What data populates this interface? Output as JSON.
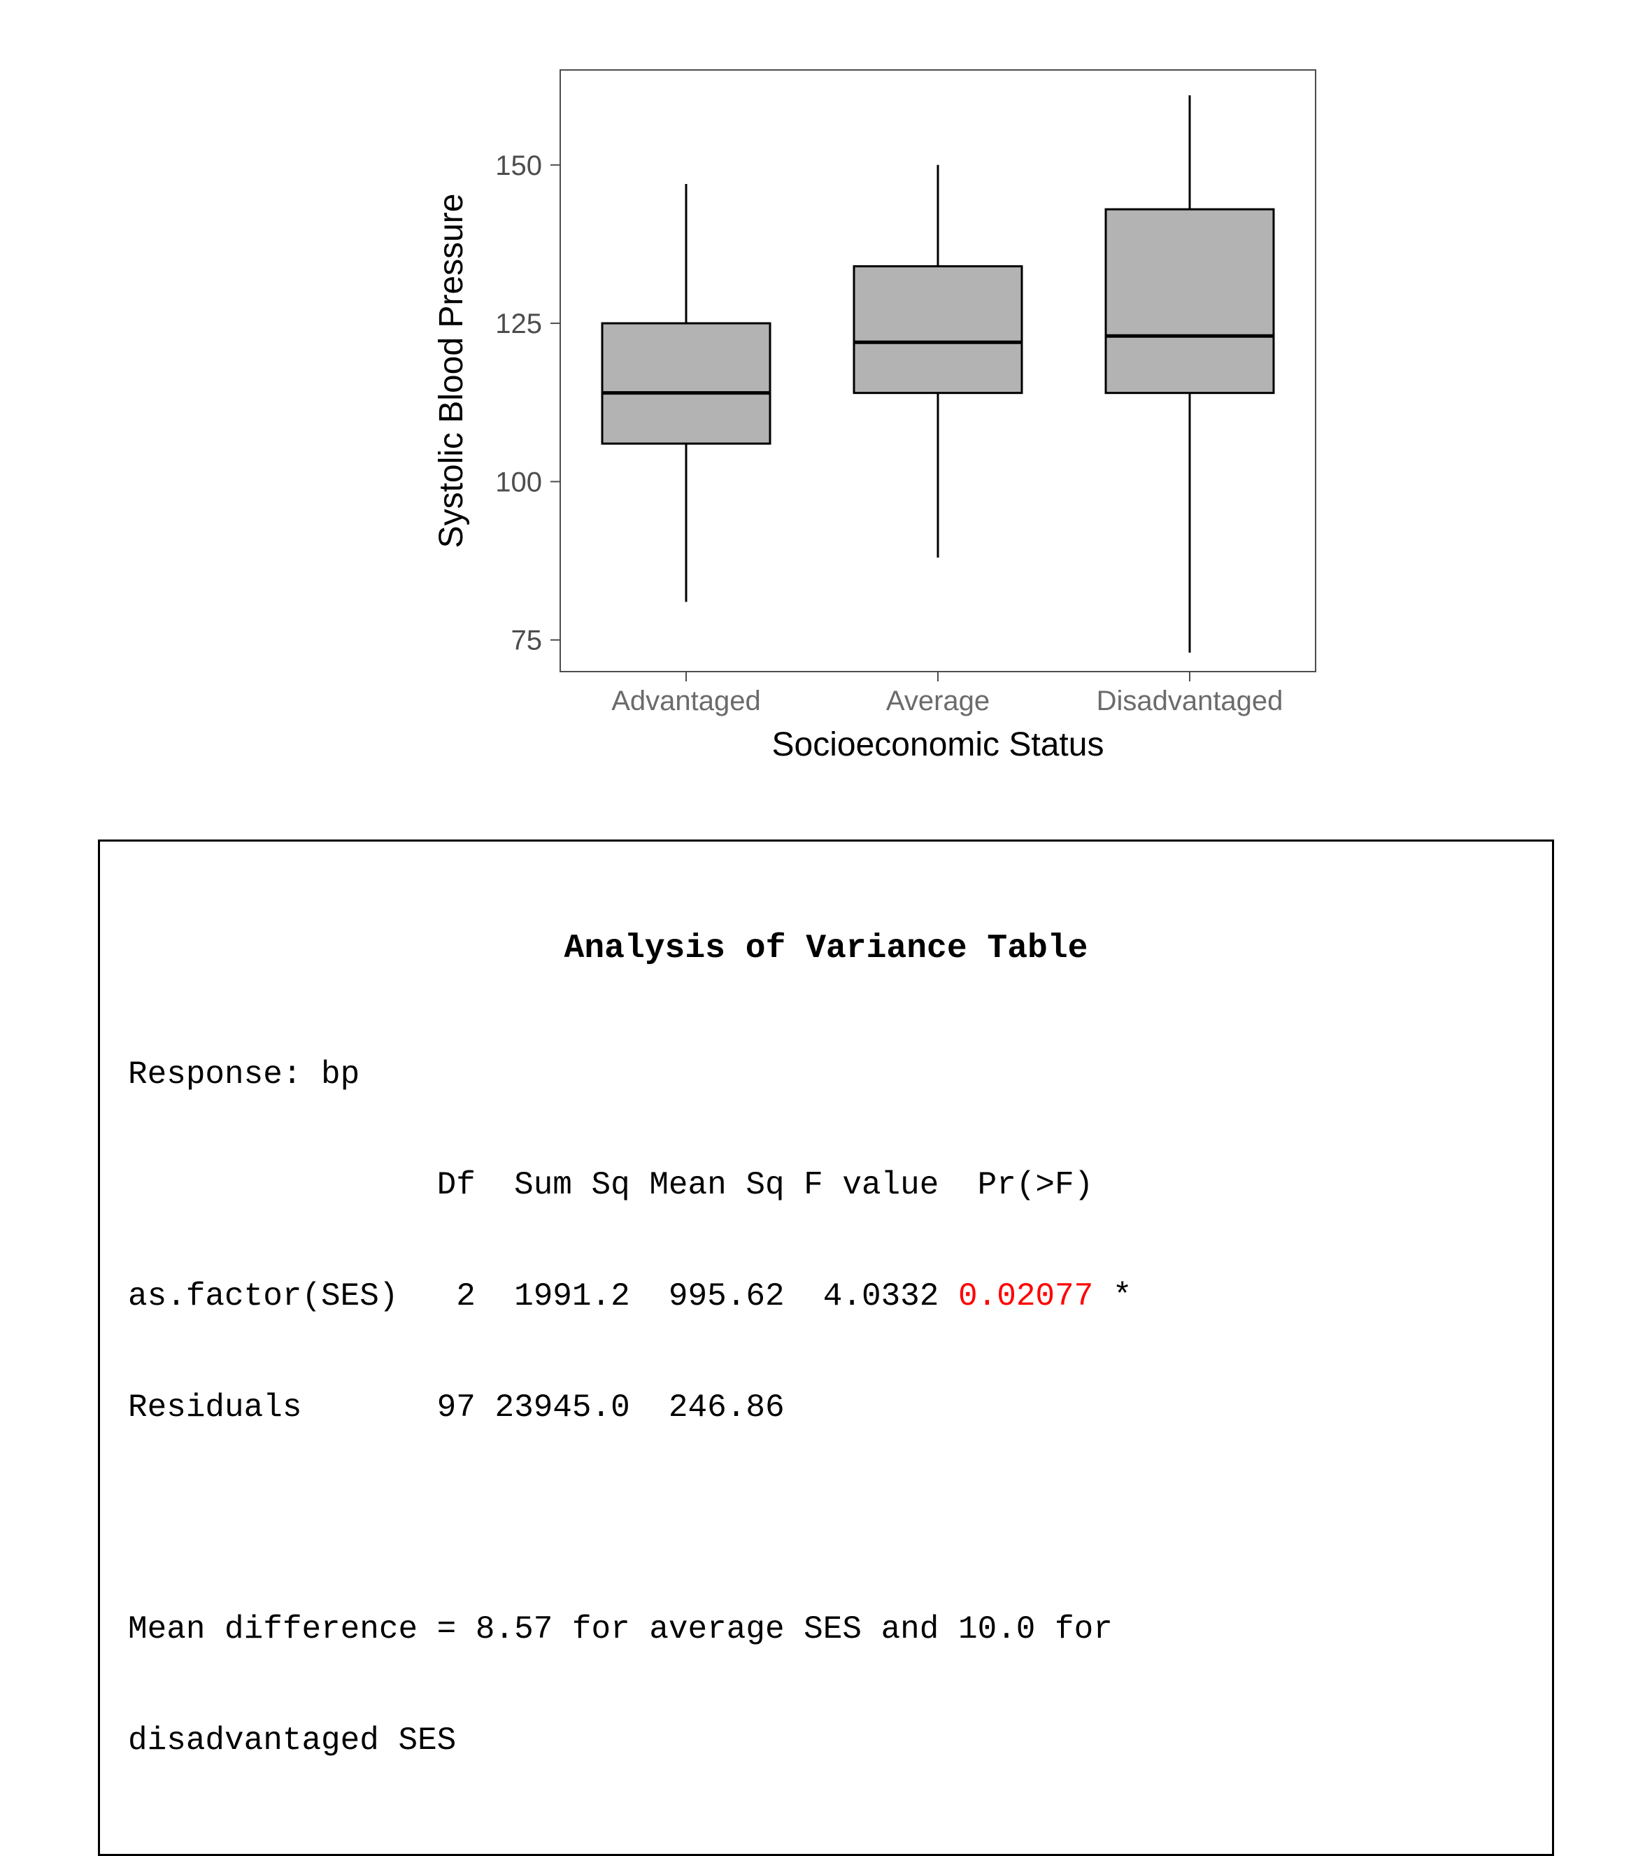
{
  "chart_data": {
    "type": "boxplot",
    "xlabel": "Socioeconomic Status",
    "ylabel": "Systolic Blood Pressure",
    "categories": [
      "Advantaged",
      "Average",
      "Disadvantaged"
    ],
    "y_ticks": [
      75,
      100,
      125,
      150
    ],
    "ylim": [
      70,
      165
    ],
    "series": [
      {
        "name": "Advantaged",
        "min": 81,
        "q1": 106,
        "median": 114,
        "q3": 125,
        "max": 147
      },
      {
        "name": "Average",
        "min": 88,
        "q1": 114,
        "median": 122,
        "q3": 134,
        "max": 150
      },
      {
        "name": "Disadvantaged",
        "min": 73,
        "q1": 114,
        "median": 123,
        "q3": 143,
        "max": 161
      }
    ]
  },
  "anova": {
    "title": "Analysis of Variance Table",
    "response_label": "Response: bp",
    "header": "                Df  Sum Sq Mean Sq F value  Pr(>F)",
    "row_factor_a": "as.factor(SES)   2  1991.2  995.62  4.0332 ",
    "row_factor_p": "0.02077",
    "row_factor_b": " *",
    "row_resid": "Residuals       97 23945.0  246.86",
    "mean_diff_1": "Mean difference = 8.57 for average SES and 10.0 for",
    "mean_diff_2": "disadvantaged SES"
  }
}
